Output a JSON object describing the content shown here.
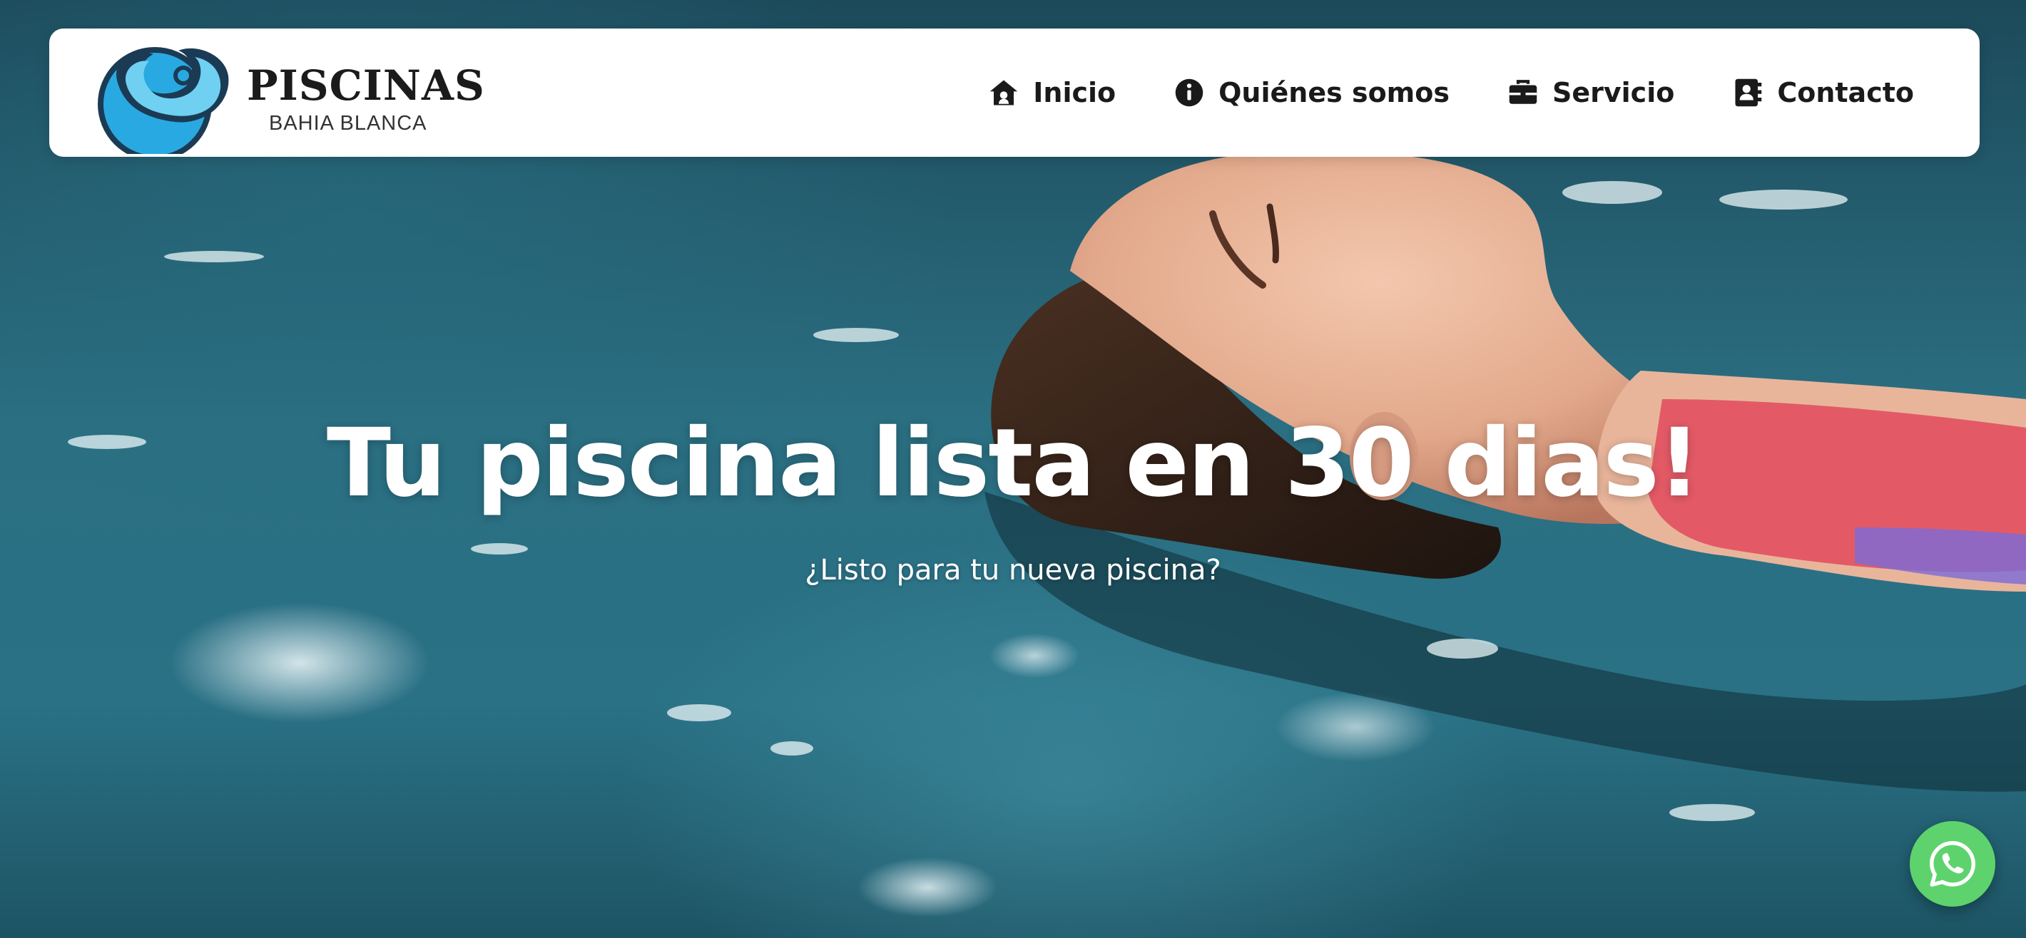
{
  "brand": {
    "name": "PISCINAS",
    "subtitle": "BAHIA BLANCA",
    "logo_icon": "wave-logo-icon",
    "logo_color": "#29a9e1"
  },
  "nav": {
    "items": [
      {
        "label": "Inicio",
        "icon": "house-icon"
      },
      {
        "label": "Quiénes somos",
        "icon": "info-circle-icon"
      },
      {
        "label": "Servicio",
        "icon": "briefcase-icon"
      },
      {
        "label": "Contacto",
        "icon": "address-book-icon"
      }
    ]
  },
  "hero": {
    "title": "Tu piscina lista en 30 dias!",
    "subtitle": "¿Listo para tu nueva piscina?"
  },
  "whatsapp": {
    "icon": "whatsapp-icon",
    "color": "#5ed36d"
  }
}
